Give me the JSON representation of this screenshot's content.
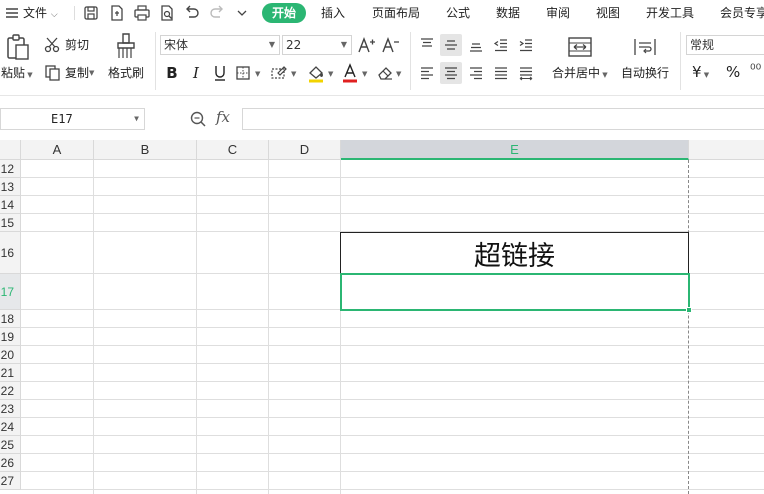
{
  "menubar": {
    "file_label": "文件",
    "tabs": [
      "开始",
      "插入",
      "页面布局",
      "公式",
      "数据",
      "审阅",
      "视图",
      "开发工具",
      "会员专享"
    ]
  },
  "ribbon": {
    "paste_label": "粘贴",
    "cut_label": "剪切",
    "copy_label": "复制",
    "format_painter_label": "格式刷",
    "font_name": "宋体",
    "font_size": "22",
    "merge_center_label": "合并居中",
    "wrap_text_label": "自动换行",
    "number_format": "常规",
    "currency_symbol": "¥",
    "percent_symbol": "%"
  },
  "formula_bar": {
    "name_box": "E17",
    "fx_label": "fx",
    "formula": ""
  },
  "sheet": {
    "columns": [
      "A",
      "B",
      "C",
      "D",
      "E"
    ],
    "selected_column": "E",
    "rows": [
      "12",
      "13",
      "14",
      "15",
      "16",
      "17",
      "18",
      "19",
      "20",
      "21",
      "22",
      "23",
      "24",
      "25",
      "26",
      "27"
    ],
    "selected_row": "17",
    "active_cell": "E17",
    "cell_E16": "超链接"
  },
  "colors": {
    "accent": "#2bb673",
    "header_bg": "#f3f3f3",
    "selected_header_bg": "#d3d6db",
    "gridline": "#dedede"
  }
}
